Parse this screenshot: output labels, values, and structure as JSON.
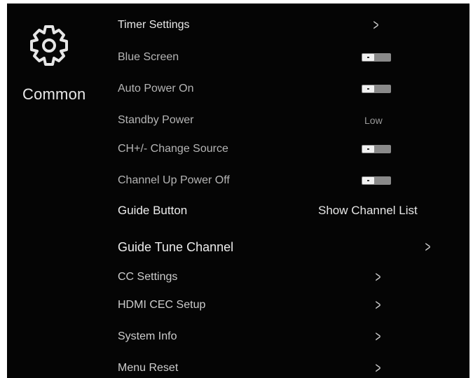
{
  "section": {
    "title": "Common",
    "icon": "gear-icon"
  },
  "settings": {
    "timer_settings": {
      "label": "Timer Settings",
      "control": "chevron"
    },
    "blue_screen": {
      "label": "Blue Screen",
      "control": "toggle",
      "state": "off"
    },
    "auto_power_on": {
      "label": "Auto Power On",
      "control": "toggle",
      "state": "off"
    },
    "standby_power": {
      "label": "Standby Power",
      "value": "Low"
    },
    "ch_change_source": {
      "label": "CH+/- Change Source",
      "control": "toggle",
      "state": "off"
    },
    "channel_up_power_off": {
      "label": "Channel Up Power Off",
      "control": "toggle",
      "state": "off"
    },
    "guide_button": {
      "label": "Guide Button",
      "value": "Show Channel List"
    },
    "guide_tune_channel": {
      "label": "Guide Tune Channel",
      "control": "chevron"
    },
    "cc_settings": {
      "label": "CC Settings",
      "control": "chevron"
    },
    "hdmi_cec_setup": {
      "label": "HDMI CEC Setup",
      "control": "chevron"
    },
    "system_info": {
      "label": "System Info",
      "control": "chevron"
    },
    "menu_reset": {
      "label": "Menu Reset",
      "control": "chevron"
    }
  },
  "chevron_glyph": ">"
}
